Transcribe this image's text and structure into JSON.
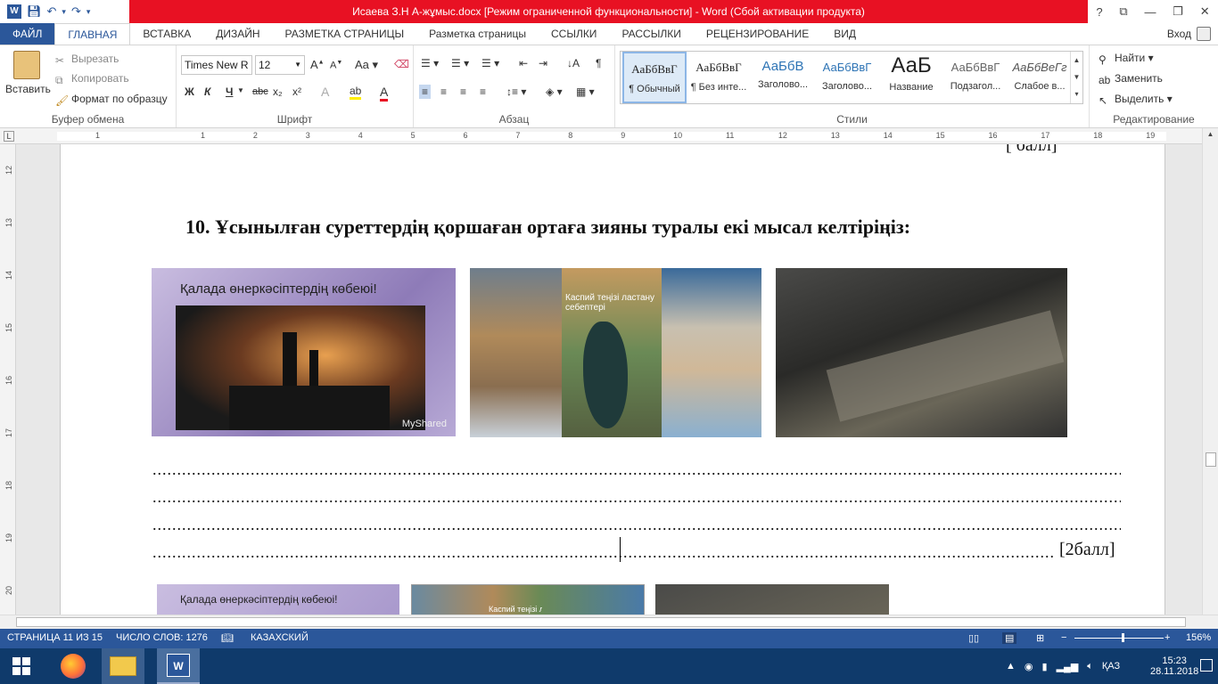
{
  "window": {
    "title": "Исаева З.Н   А-жұмыс.docx [Режим ограниченной функциональности] -  Word (Сбой активации продукта)",
    "controls": [
      "?",
      "⧉",
      "—",
      "❐",
      "✕"
    ]
  },
  "tabs": [
    {
      "label": "ФАЙЛ"
    },
    {
      "label": "ГЛАВНАЯ"
    },
    {
      "label": "ВСТАВКА"
    },
    {
      "label": "ДИЗАЙН"
    },
    {
      "label": "РАЗМЕТКА СТРАНИЦЫ"
    },
    {
      "label": "Разметка страницы"
    },
    {
      "label": "ССЫЛКИ"
    },
    {
      "label": "РАССЫЛКИ"
    },
    {
      "label": "РЕЦЕНЗИРОВАНИЕ"
    },
    {
      "label": "ВИД"
    }
  ],
  "signin": "Вход",
  "clipboard": {
    "paste": "Вставить",
    "cut": "Вырезать",
    "copy": "Копировать",
    "format_painter": "Формат по образцу",
    "label": "Буфер обмена"
  },
  "font": {
    "name": "Times New R",
    "size": "12",
    "bold": "Ж",
    "italic": "К",
    "underline": "Ч",
    "strike": "abc",
    "sub": "x₂",
    "sup": "x²",
    "label": "Шрифт",
    "case": "Aa"
  },
  "paragraph": {
    "label": "Абзац"
  },
  "styles": {
    "label": "Стили",
    "items": [
      {
        "sample": "АаБбВвГ",
        "name": "¶ Обычный"
      },
      {
        "sample": "АаБбВвГ",
        "name": "¶ Без инте..."
      },
      {
        "sample": "АаБбВ",
        "name": "Заголово..."
      },
      {
        "sample": "АаБбВвГ",
        "name": "Заголово..."
      },
      {
        "sample": "АаБ",
        "name": "Название"
      },
      {
        "sample": "АаБбВвГ",
        "name": "Подзагол..."
      },
      {
        "sample": "АаБбВеГг",
        "name": "Слабое в..."
      }
    ]
  },
  "editing": {
    "find": "Найти",
    "replace": "Заменить",
    "select": "Выделить",
    "label": "Редактирование"
  },
  "ruler": {
    "top": [
      "1",
      "1",
      "2",
      "3",
      "4",
      "5",
      "6",
      "7",
      "8",
      "9",
      "10",
      "11",
      "12",
      "13",
      "14",
      "15",
      "16",
      "17",
      "18",
      "19"
    ],
    "left": [
      "12",
      "13",
      "14",
      "15",
      "16",
      "17",
      "18",
      "19",
      "20"
    ]
  },
  "document": {
    "question": "10. Ұсынылған суреттердің қоршаған ортаға зияны туралы екі мысал  келтіріңіз:",
    "image1_caption": "Қалада өнеркәсіптердің көбеюі!",
    "image1_watermark": "MyShared",
    "image2_title": "Каспий теңізі ластану себептері",
    "dots": "..........................................................................................................................................................................................................................................................................",
    "score": "[2балл]",
    "top_fragment": "[ балл]"
  },
  "status": {
    "page": "СТРАНИЦА 11 ИЗ 15",
    "words": "ЧИСЛО СЛОВ: 1276",
    "language": "КАЗАХСКИЙ",
    "zoom": "156%"
  },
  "tray": {
    "lang": "ҚАЗ",
    "time": "15:23",
    "date": "28.11.2018"
  },
  "colors": {
    "word_blue": "#2b579a",
    "title_red": "#e81123",
    "taskbar": "#0f3a6b"
  }
}
